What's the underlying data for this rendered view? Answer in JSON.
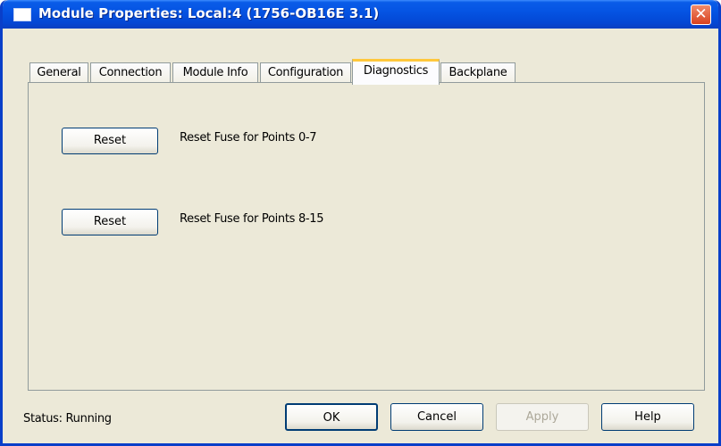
{
  "window": {
    "title": "Module Properties: Local:4 (1756-OB16E 3.1)",
    "close_symbol": "✕"
  },
  "tabs": [
    {
      "label": "General"
    },
    {
      "label": "Connection"
    },
    {
      "label": "Module Info"
    },
    {
      "label": "Configuration"
    },
    {
      "label": "Diagnostics",
      "active": true
    },
    {
      "label": "Backplane"
    }
  ],
  "diagnostics": {
    "reset_1_label": "Reset",
    "reset_1_desc": "Reset Fuse for Points 0-7",
    "reset_2_label": "Reset",
    "reset_2_desc": "Reset Fuse for Points 8-15"
  },
  "footer": {
    "status": "Status:  Running",
    "ok": "OK",
    "cancel": "Cancel",
    "apply": "Apply",
    "help": "Help"
  },
  "colors": {
    "titlebar": "#0554e3",
    "active_tab_accent": "#ffc83c",
    "dialog_bg": "#ece9d8"
  }
}
